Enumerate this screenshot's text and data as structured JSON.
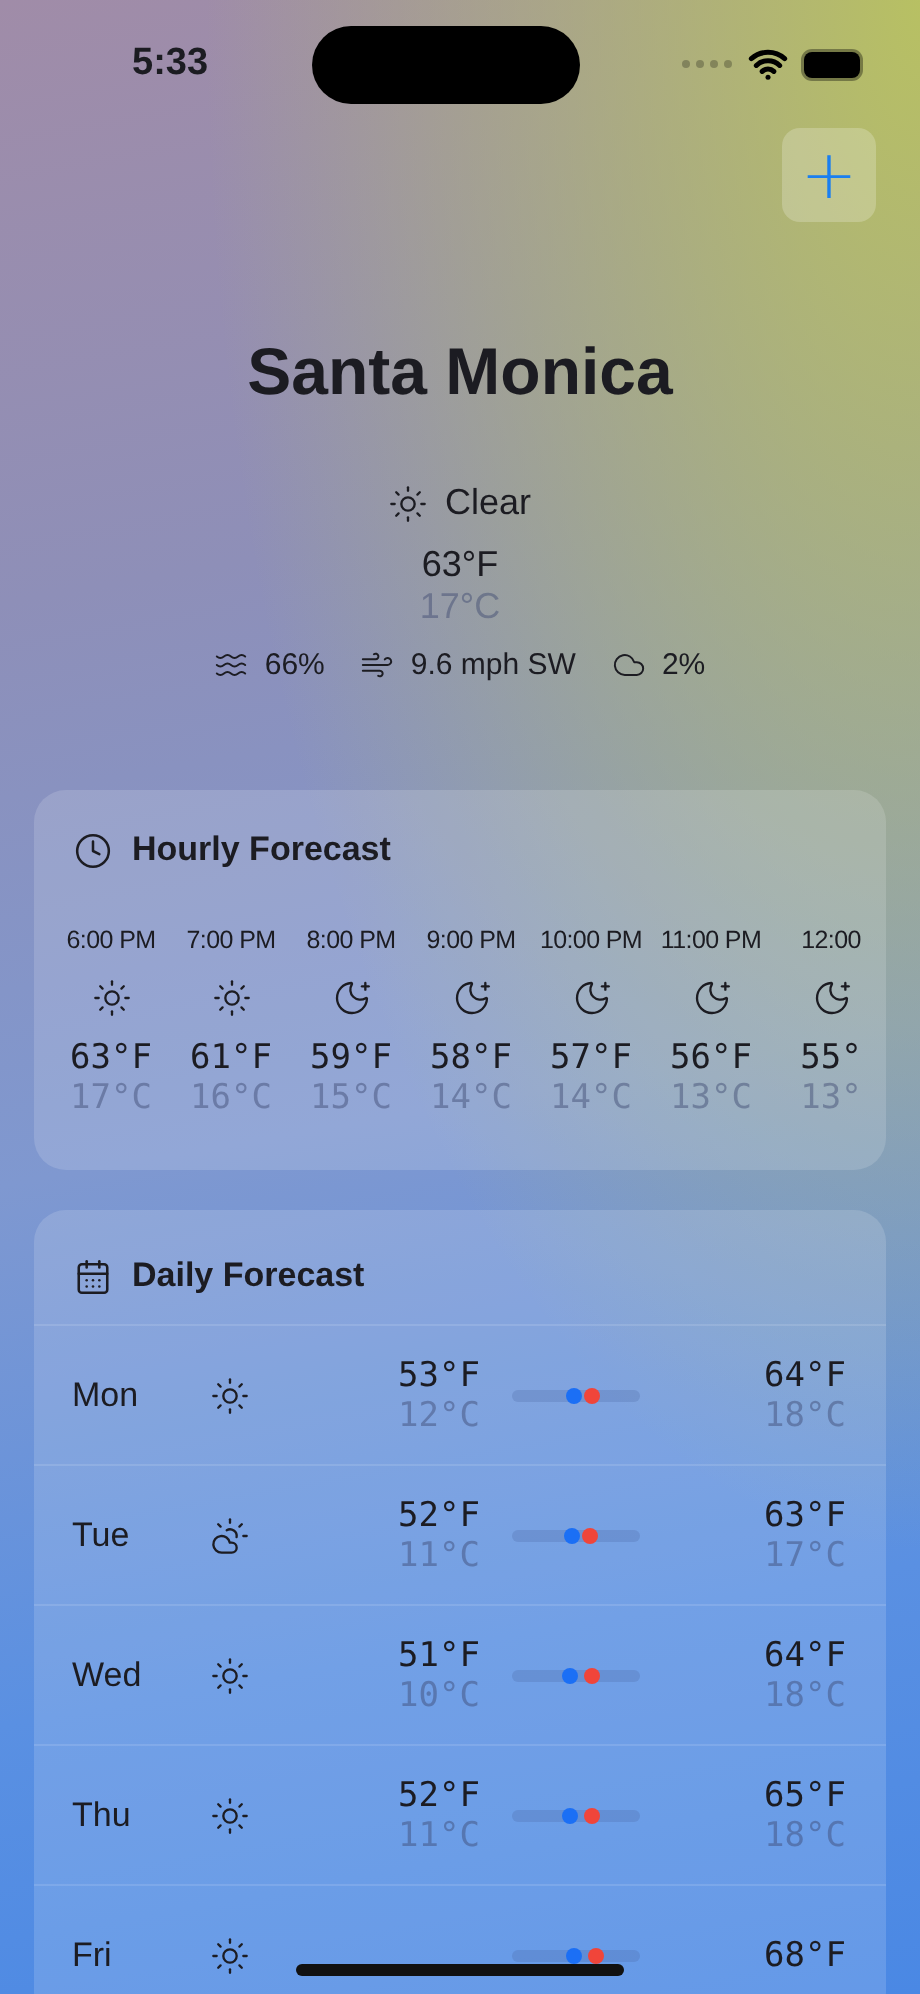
{
  "status_bar": {
    "time": "5:33"
  },
  "add_button": {
    "label": "+"
  },
  "location": {
    "name": "Santa Monica",
    "condition": {
      "kind": "sun",
      "text": "Clear"
    },
    "temp_f": "63°F",
    "temp_c": "17°C",
    "stats": [
      {
        "kind": "humidity",
        "text": "66%"
      },
      {
        "kind": "wind",
        "text": "9.6 mph SW"
      },
      {
        "kind": "cloud",
        "text": "2%"
      }
    ]
  },
  "hourly": {
    "title": "Hourly Forecast",
    "hours": [
      {
        "time": "6:00 PM",
        "kind": "sun",
        "temp_f": "63°F",
        "temp_c": "17°C"
      },
      {
        "time": "7:00 PM",
        "kind": "sun",
        "temp_f": "61°F",
        "temp_c": "16°C"
      },
      {
        "time": "8:00 PM",
        "kind": "moon",
        "temp_f": "59°F",
        "temp_c": "15°C"
      },
      {
        "time": "9:00 PM",
        "kind": "moon",
        "temp_f": "58°F",
        "temp_c": "14°C"
      },
      {
        "time": "10:00 PM",
        "kind": "moon",
        "temp_f": "57°F",
        "temp_c": "14°C"
      },
      {
        "time": "11:00 PM",
        "kind": "moon",
        "temp_f": "56°F",
        "temp_c": "13°C"
      },
      {
        "time": "12:00",
        "kind": "moon",
        "temp_f": "55°",
        "temp_c": "13°"
      }
    ]
  },
  "daily": {
    "title": "Daily Forecast",
    "days": [
      {
        "day": "Mon",
        "kind": "sun",
        "low_f": "53°F",
        "low_c": "12°C",
        "low": {
          "level": 0.49
        },
        "high": {
          "level": 0.62
        },
        "high_f": "64°F",
        "high_c": "18°C"
      },
      {
        "day": "Tue",
        "kind": "cloud-sun",
        "low_f": "52°F",
        "low_c": "11°C",
        "low": {
          "level": 0.47
        },
        "high": {
          "level": 0.61
        },
        "high_f": "63°F",
        "high_c": "17°C"
      },
      {
        "day": "Wed",
        "kind": "sun",
        "low_f": "51°F",
        "low_c": "10°C",
        "low": {
          "level": 0.46
        },
        "high": {
          "level": 0.62
        },
        "high_f": "64°F",
        "high_c": "18°C"
      },
      {
        "day": "Thu",
        "kind": "sun",
        "low_f": "52°F",
        "low_c": "11°C",
        "low": {
          "level": 0.46
        },
        "high": {
          "level": 0.63
        },
        "high_f": "65°F",
        "high_c": "18°C"
      },
      {
        "day": "Fri",
        "kind": "sun",
        "low": {
          "level": 0.48
        },
        "high": {
          "level": 0.65
        },
        "high_f": "68°F"
      }
    ]
  }
}
